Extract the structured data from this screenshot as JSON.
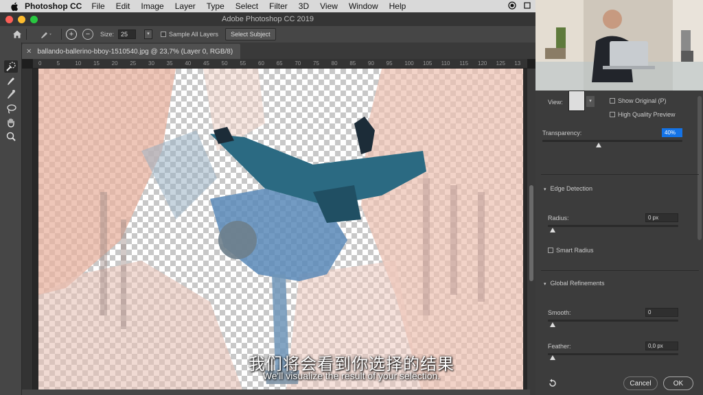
{
  "menubar": {
    "app_name": "Photoshop CC",
    "items": [
      "File",
      "Edit",
      "Image",
      "Layer",
      "Type",
      "Select",
      "Filter",
      "3D",
      "View",
      "Window",
      "Help"
    ]
  },
  "window": {
    "title": "Adobe Photoshop CC 2019"
  },
  "options": {
    "size_label": "Size:",
    "size_value": "25",
    "sample_all_label": "Sample All Layers",
    "select_subject_label": "Select Subject"
  },
  "document": {
    "tab_title": "ballando-ballerino-bboy-1510540.jpg @ 23,7% (Layer 0, RGB/8)",
    "ruler_ticks": [
      "0",
      "5",
      "10",
      "15",
      "20",
      "25",
      "30",
      "35",
      "40",
      "45",
      "50",
      "55",
      "60",
      "65",
      "70",
      "75",
      "80",
      "85",
      "90",
      "95",
      "100",
      "105",
      "110",
      "115",
      "120",
      "125",
      "13"
    ]
  },
  "properties": {
    "view_label": "View:",
    "show_original_label": "Show Original (P)",
    "high_quality_label": "High Quality Preview",
    "transparency_label": "Transparency:",
    "transparency_value": "40%",
    "transparency_level": 0.4,
    "edge_detection_title": "Edge Detection",
    "radius_label": "Radius:",
    "radius_value": "0 px",
    "smart_radius_label": "Smart Radius",
    "global_refinements_title": "Global Refinements",
    "smooth_label": "Smooth:",
    "smooth_value": "0",
    "feather_label": "Feather:",
    "feather_value": "0,0 px",
    "cancel_label": "Cancel",
    "ok_label": "OK"
  },
  "subtitles": {
    "zh": "我们将会看到你选择的结果",
    "en": "We'll visualize the result of your selection."
  },
  "colors": {
    "accent_blue": "#1473e6",
    "close": "#fc5f57",
    "minimize": "#fdbc2e",
    "maximize": "#28c840"
  }
}
